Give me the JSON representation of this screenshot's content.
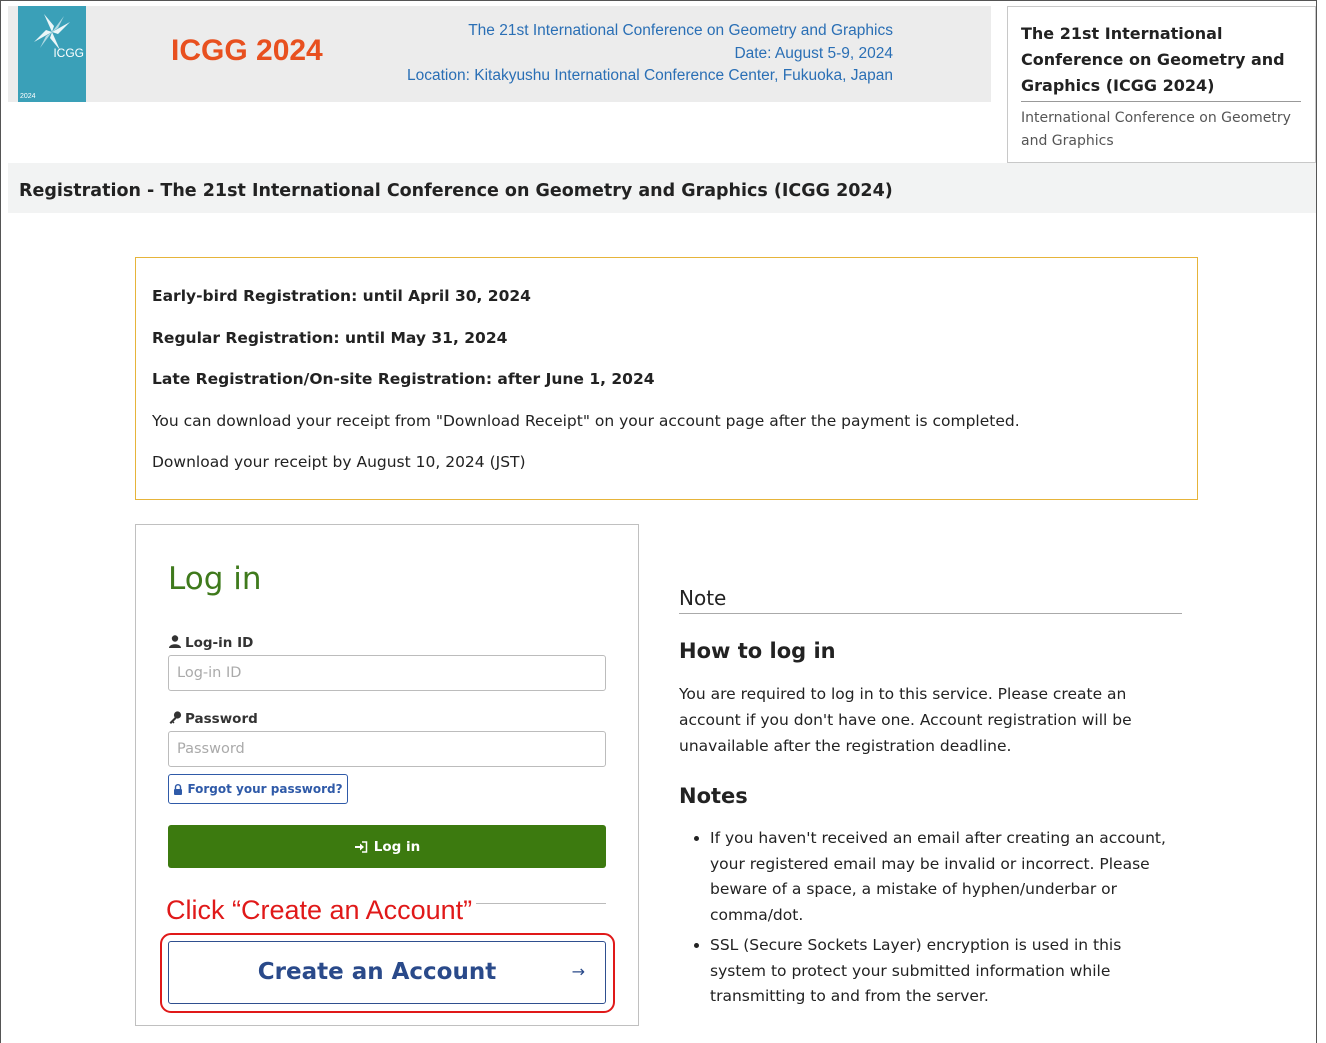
{
  "header": {
    "logo_text": "ICGG",
    "logo_year": "2024",
    "brand": "ICGG 2024",
    "conference_name": "The 21st International Conference on Geometry and Graphics",
    "date": "Date: August 5-9, 2024",
    "location": "Location: Kitakyushu International Conference Center, Fukuoka, Japan"
  },
  "side_box": {
    "title": "The 21st International Conference on Geometry and Graphics (ICGG 2024)",
    "subtitle": "International Conference on Geometry and Graphics"
  },
  "page_title": "Registration - The 21st International Conference on Geometry and Graphics (ICGG 2024)",
  "info": {
    "early_bird": "Early-bird Registration: until April 30, 2024",
    "regular": "Regular Registration: until May 31, 2024",
    "late": "Late Registration/On-site Registration: after June 1, 2024",
    "receipt_note": "You can download your receipt from \"Download Receipt\" on your account page after the payment is completed.",
    "receipt_deadline": "Download your receipt by August 10, 2024 (JST)"
  },
  "login": {
    "title": "Log in",
    "login_id_label": "Log-in ID",
    "login_id_placeholder": "Log-in ID",
    "password_label": "Password",
    "password_placeholder": "Password",
    "forgot_label": "Forgot your password?",
    "login_button": "Log in",
    "click_hint": "Click “Create an Account”",
    "create_account": "Create an Account",
    "create_arrow": "→"
  },
  "notes": {
    "heading": "Note",
    "how_title": "How to log in",
    "how_text": "You are required to log in to this service. Please create an account if you don't have one. Account registration will be unavailable after the registration deadline.",
    "notes_title": "Notes",
    "items": [
      "If you haven't received an email after creating an account, your registered email may be invalid or incorrect. Please beware of a space, a mistake of hyphen/underbar or comma/dot.",
      "SSL (Secure Sockets Layer) encryption is used in this system to protect your submitted information while transmitting to and from the server."
    ]
  },
  "colors": {
    "brand": "#e8501f",
    "info_text": "#2a6fb5",
    "login_green": "#3c7a0f",
    "highlight_red": "#e01919",
    "info_border": "#e6b43a"
  }
}
